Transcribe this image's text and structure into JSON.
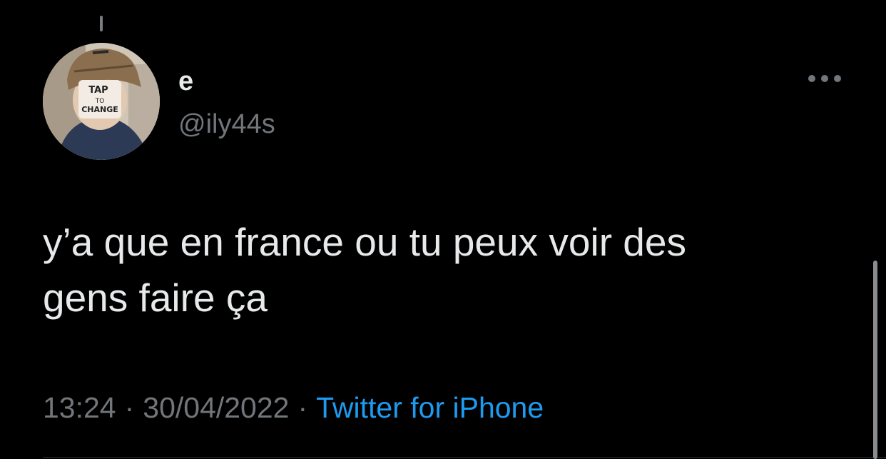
{
  "author": {
    "display_name": "e",
    "handle": "@ily44s",
    "avatar_sign_text": [
      "TAP",
      "TO",
      "CHANGE"
    ]
  },
  "tweet": {
    "text": "y’a que en france ou tu peux voir des\ngens faire ça",
    "time": "13:24",
    "date": "30/04/2022",
    "separator": "·",
    "source": "Twitter for iPhone"
  },
  "icons": {
    "more": "more-horizontal-icon"
  },
  "colors": {
    "background": "#000000",
    "text_primary": "#e7e9ea",
    "text_secondary": "#71767b",
    "link": "#1d9bf0"
  }
}
